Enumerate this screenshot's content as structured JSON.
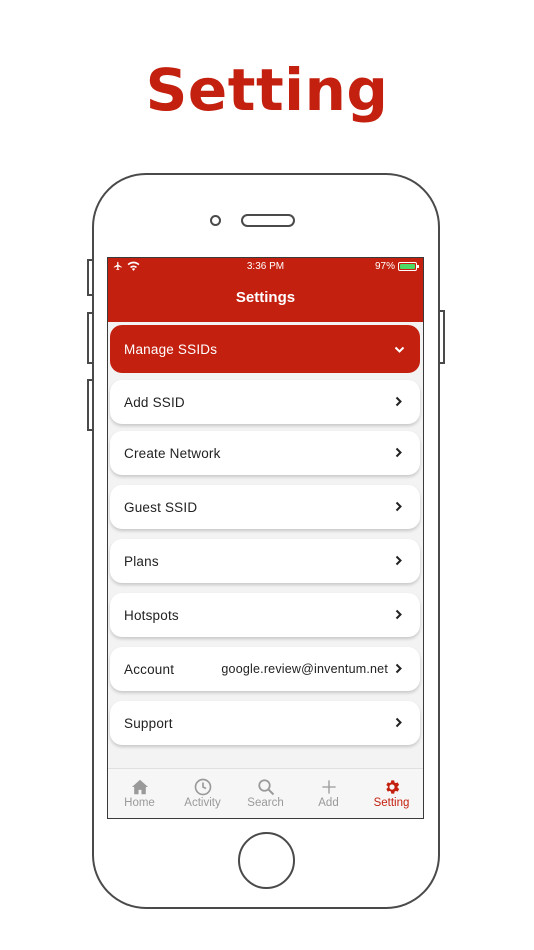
{
  "promo": {
    "title": "Setting"
  },
  "status_bar": {
    "time": "3:36 PM",
    "battery": "97%",
    "battery_level": 0.97
  },
  "header": {
    "title": "Settings"
  },
  "menu": [
    {
      "label": "Manage SSIDs",
      "value": "",
      "chevron": "chevron-down",
      "active": true
    },
    {
      "label": "Add SSID",
      "value": "",
      "chevron": "chevron-right"
    },
    {
      "label": "Create Network",
      "value": "",
      "chevron": "chevron-right"
    },
    {
      "label": "Guest SSID",
      "value": "",
      "chevron": "chevron-right"
    },
    {
      "label": "Plans",
      "value": "",
      "chevron": "chevron-right"
    },
    {
      "label": "Hotspots",
      "value": "",
      "chevron": "chevron-right"
    },
    {
      "label": "Account",
      "value": "google.review@inventum.net",
      "chevron": "chevron-right"
    },
    {
      "label": "Support",
      "value": "",
      "chevron": "chevron-right"
    }
  ],
  "tabs": [
    {
      "label": "Home",
      "icon": "home-icon"
    },
    {
      "label": "Activity",
      "icon": "clock-icon"
    },
    {
      "label": "Search",
      "icon": "search-icon"
    },
    {
      "label": "Add",
      "icon": "plus-icon"
    },
    {
      "label": "Setting",
      "icon": "gear-icon",
      "active": true
    }
  ],
  "colors": {
    "accent": "#c4200f",
    "tab_inactive": "#9a9a9a",
    "background": "#f3f3f3"
  }
}
